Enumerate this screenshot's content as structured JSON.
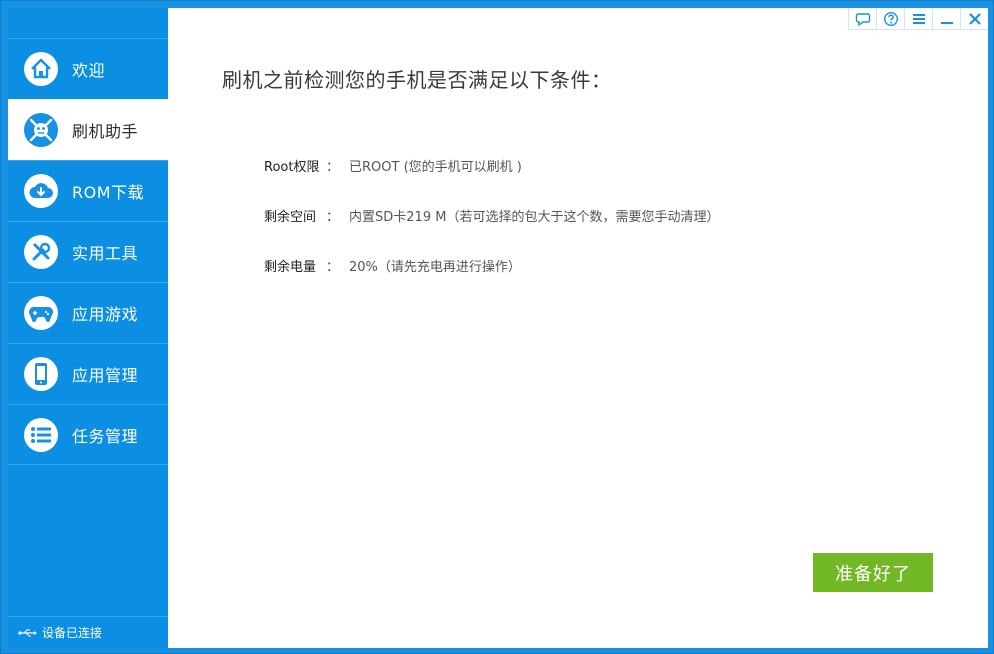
{
  "sidebar": {
    "items": [
      {
        "label": "欢迎",
        "icon": "home-icon"
      },
      {
        "label": "刷机助手",
        "icon": "android-robot-icon"
      },
      {
        "label": "ROM下载",
        "icon": "cloud-download-icon"
      },
      {
        "label": "实用工具",
        "icon": "tools-icon"
      },
      {
        "label": "应用游戏",
        "icon": "gamepad-icon"
      },
      {
        "label": "应用管理",
        "icon": "phone-icon"
      },
      {
        "label": "任务管理",
        "icon": "list-icon"
      }
    ],
    "active_index": 1,
    "status": "设备已连接"
  },
  "window_controls": [
    "feedback-icon",
    "help-icon",
    "menu-icon",
    "minimize-icon",
    "close-icon"
  ],
  "main": {
    "title": "刷机之前检测您的手机是否满足以下条件：",
    "conditions": [
      {
        "label": "Root权限",
        "colon": "：",
        "value": "已ROOT (您的手机可以刷机 )"
      },
      {
        "label": "剩余空间",
        "colon": "：",
        "value": "内置SD卡219 M（若可选择的包大于这个数，需要您手动清理）"
      },
      {
        "label": "剩余电量",
        "colon": "：",
        "value": "20%（请先充电再进行操作）"
      }
    ],
    "ready_button": "准备好了"
  },
  "colors": {
    "sidebar_bg": "#0c8fe3",
    "frame": "#1991e3",
    "ready_button": "#72b724"
  }
}
